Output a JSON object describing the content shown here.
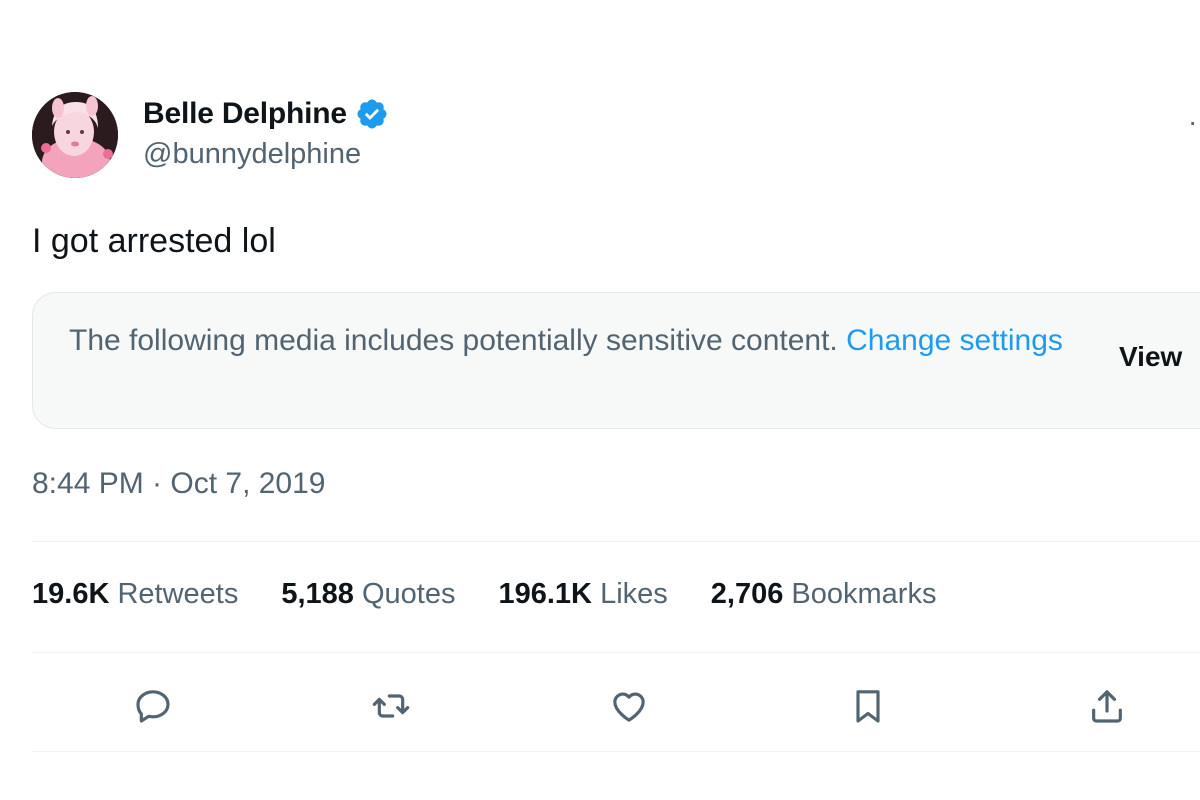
{
  "author": {
    "display_name": "Belle Delphine",
    "handle": "@bunnydelphine",
    "verified": true,
    "avatar_icon": "profile-photo"
  },
  "tweet": {
    "text": "I got arrested lol",
    "timestamp": "8:44 PM · Oct 7, 2019"
  },
  "sensitive_notice": {
    "message": "The following media includes potentially sensitive content.",
    "link_label": "Change settings",
    "view_label": "View"
  },
  "stats": [
    {
      "count": "19.6K",
      "label": "Retweets"
    },
    {
      "count": "5,188",
      "label": "Quotes"
    },
    {
      "count": "196.1K",
      "label": "Likes"
    },
    {
      "count": "2,706",
      "label": "Bookmarks"
    }
  ],
  "actions": [
    "reply-icon",
    "retweet-icon",
    "like-icon",
    "bookmark-icon",
    "share-icon"
  ],
  "colors": {
    "accent": "#1d9bf0",
    "text_primary": "#0f1419",
    "text_secondary": "#536471",
    "notice_bg": "#f7f9f9"
  }
}
